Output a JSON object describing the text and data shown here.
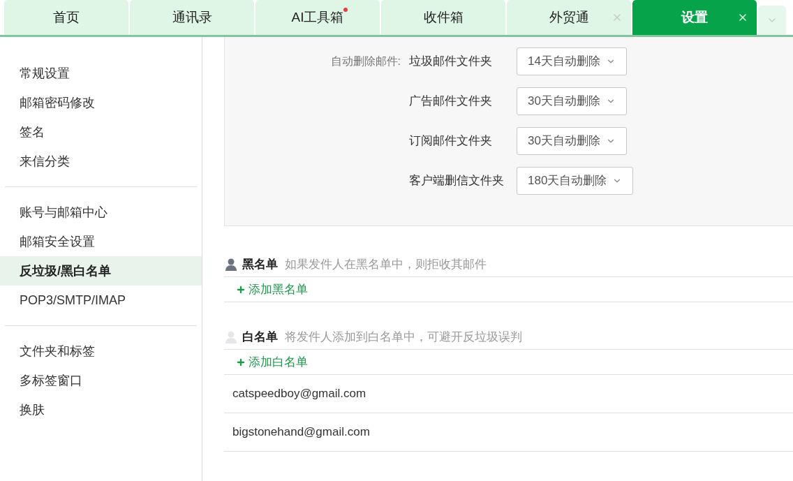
{
  "tabs": [
    {
      "label": "首页",
      "selected": false,
      "closable": false,
      "dot": false
    },
    {
      "label": "通讯录",
      "selected": false,
      "closable": false,
      "dot": false
    },
    {
      "label": "AI工具箱",
      "selected": false,
      "closable": false,
      "dot": true
    },
    {
      "label": "收件箱",
      "selected": false,
      "closable": false,
      "dot": false
    },
    {
      "label": "外贸通",
      "selected": false,
      "closable": true,
      "dot": false
    },
    {
      "label": "设置",
      "selected": true,
      "closable": true,
      "dot": false
    }
  ],
  "sidebar": {
    "groups": [
      {
        "items": [
          {
            "label": "常规设置",
            "selected": false
          },
          {
            "label": "邮箱密码修改",
            "selected": false
          },
          {
            "label": "签名",
            "selected": false
          },
          {
            "label": "来信分类",
            "selected": false
          }
        ]
      },
      {
        "items": [
          {
            "label": "账号与邮箱中心",
            "selected": false
          },
          {
            "label": "邮箱安全设置",
            "selected": false
          },
          {
            "label": "反垃圾/黑白名单",
            "selected": true
          },
          {
            "label": "POP3/SMTP/IMAP",
            "selected": false
          }
        ]
      },
      {
        "items": [
          {
            "label": "文件夹和标签",
            "selected": false
          },
          {
            "label": "多标签窗口",
            "selected": false
          },
          {
            "label": "换肤",
            "selected": false
          }
        ]
      }
    ]
  },
  "auto_delete": {
    "label": "自动删除邮件:",
    "rows": [
      {
        "folder": "垃圾邮件文件夹",
        "value": "14天自动删除"
      },
      {
        "folder": "广告邮件文件夹",
        "value": "30天自动删除"
      },
      {
        "folder": "订阅邮件文件夹",
        "value": "30天自动删除"
      },
      {
        "folder": "客户端删信文件夹",
        "value": "180天自动删除"
      }
    ]
  },
  "lists": [
    {
      "title": "黑名单",
      "description": "如果发件人在黑名单中，则拒收其邮件",
      "color": "#6b7280",
      "add_label": "添加黑名单"
    },
    {
      "title": "白名单",
      "description": "将发件人添加到白名单中，可避开反垃圾误判",
      "color": "#e5e7eb",
      "add_label": "添加白名单",
      "entries": [
        "catspeedboy@gmail.com",
        "bigstonehand@gmail.com"
      ]
    }
  ]
}
